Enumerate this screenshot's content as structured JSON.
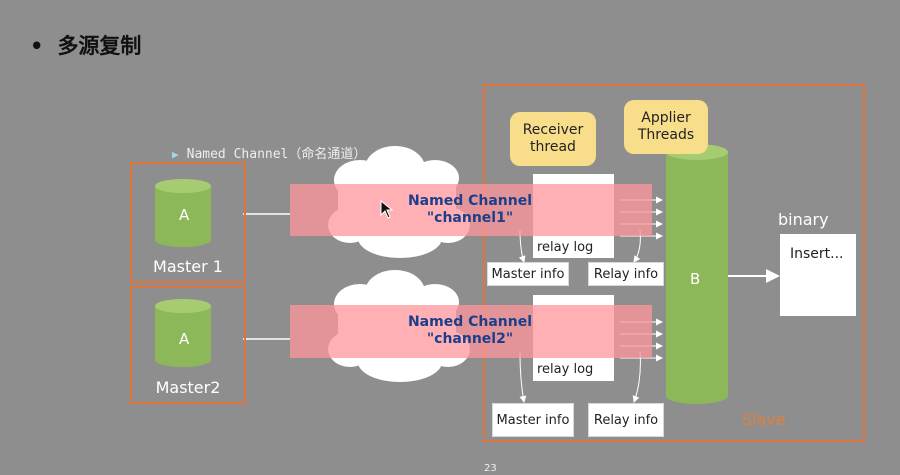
{
  "title": {
    "bullet": "•",
    "text": "多源复制"
  },
  "subtitle": {
    "marker": "▶",
    "text": "Named Channel（命名通道）"
  },
  "masters": [
    {
      "db_label": "A",
      "label": "Master 1"
    },
    {
      "db_label": "A",
      "label": "Master2"
    }
  ],
  "channels": [
    {
      "line1": "Named Channel",
      "line2": "\"channel1\"",
      "relay_log": "relay log",
      "master_info": "Master info",
      "relay_info": "Relay info"
    },
    {
      "line1": "Named Channel",
      "line2": "\"channel2\"",
      "relay_log": "relay log",
      "master_info": "Master info",
      "relay_info": "Relay info"
    }
  ],
  "callouts": {
    "receiver": "Receiver thread",
    "applier": "Applier Threads"
  },
  "slave": {
    "db_label": "B",
    "label": "Slave"
  },
  "binary": {
    "label": "binary",
    "content": "Insert..."
  },
  "page_number": "23",
  "colors": {
    "background": "#8e8e8e",
    "border_orange": "#e0743d",
    "db_green": "#8db85a",
    "channel_pink": "#ff969b",
    "channel_text": "#1d3e8a",
    "callout_yellow": "#f8de8a"
  }
}
